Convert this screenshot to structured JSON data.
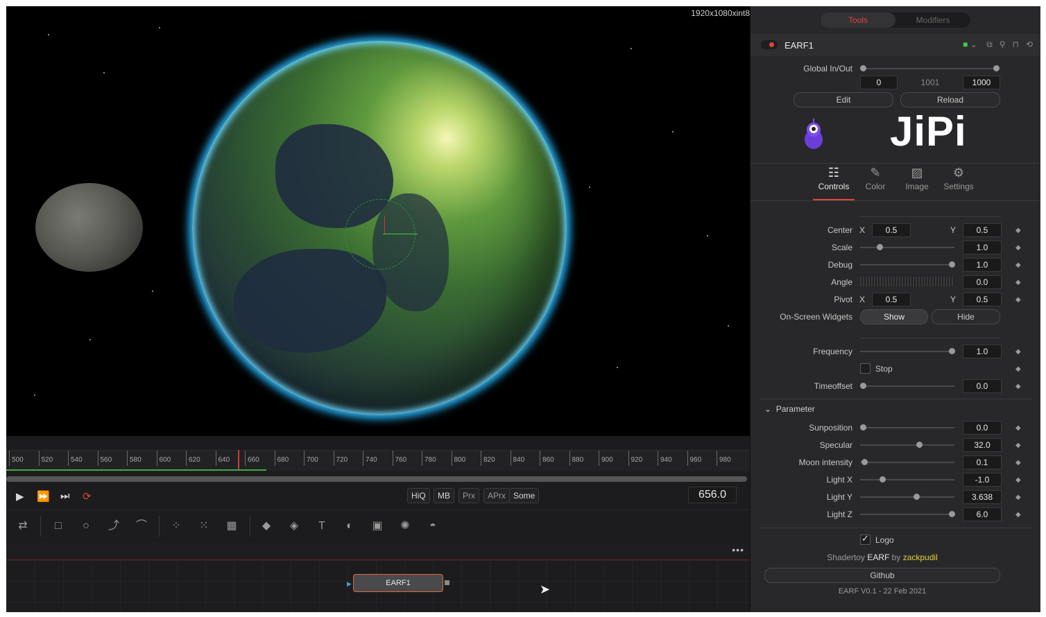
{
  "viewer": {
    "resolution": "1920x1080xint8"
  },
  "timeline": {
    "ticks": [
      "500",
      "520",
      "540",
      "560",
      "580",
      "600",
      "620",
      "640",
      "660",
      "680",
      "700",
      "720",
      "740",
      "760",
      "780",
      "800",
      "820",
      "840",
      "860",
      "880",
      "900",
      "920",
      "940",
      "960",
      "980"
    ],
    "current_frame": "656.0"
  },
  "transport": {
    "hiq": "HiQ",
    "mb": "MB",
    "prx": "Prx",
    "aprx": "APrx",
    "some": "Some"
  },
  "node": {
    "name": "EARF1"
  },
  "inspector": {
    "tabs": [
      "Tools",
      "Modifiers"
    ],
    "node_name": "EARF1",
    "global_inout_label": "Global In/Out",
    "global_in": "0",
    "global_mid": "1001",
    "global_out": "1000",
    "edit_label": "Edit",
    "reload_label": "Reload",
    "logo_text": "JiPi",
    "control_tabs": [
      "Controls",
      "Color",
      "Image",
      "Settings"
    ],
    "center_label": "Center",
    "center_x": "0.5",
    "center_y": "0.5",
    "x_label": "X",
    "y_label": "Y",
    "scale_label": "Scale",
    "scale": "1.0",
    "debug_label": "Debug",
    "debug": "1.0",
    "angle_label": "Angle",
    "angle": "0.0",
    "pivot_label": "Pivot",
    "pivot_x": "0.5",
    "pivot_y": "0.5",
    "widgets_label": "On-Screen Widgets",
    "show_label": "Show",
    "hide_label": "Hide",
    "frequency_label": "Frequency",
    "frequency": "1.0",
    "stop_label": "Stop",
    "timeoffset_label": "Timeoffset",
    "timeoffset": "0.0",
    "parameter_label": "Parameter",
    "sunposition_label": "Sunposition",
    "sunposition": "0.0",
    "specular_label": "Specular",
    "specular": "32.0",
    "moon_label": "Moon intensity",
    "moon": "0.1",
    "lightx_label": "Light X",
    "lightx": "-1.0",
    "lighty_label": "Light Y",
    "lighty": "3.638",
    "lightz_label": "Light Z",
    "lightz": "6.0",
    "logo_label": "Logo",
    "credit_prefix": "Shadertoy",
    "credit_shader": "EARF",
    "credit_by": "by",
    "credit_author": "zackpudil",
    "github_label": "Github",
    "version": "EARF V0.1 - 22 Feb 2021"
  },
  "colors": {
    "accent": "#e0443b",
    "author": "#e8d23a",
    "glow": "#27b8ff"
  }
}
